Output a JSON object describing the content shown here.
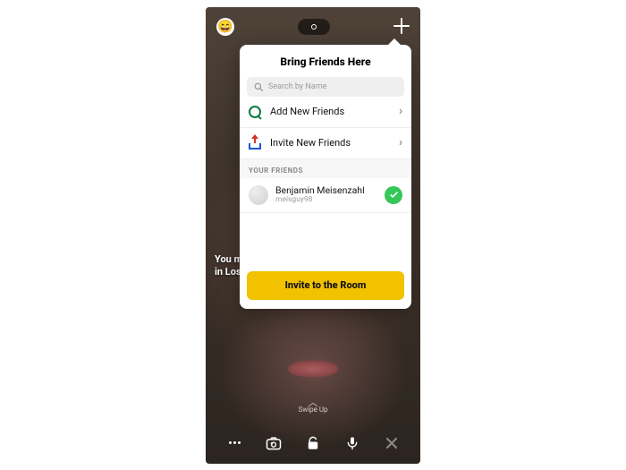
{
  "topbar": {
    "emoji": "😄"
  },
  "background_message": {
    "line1": "You m",
    "line2": "in Los"
  },
  "popover": {
    "title": "Bring Friends Here",
    "search_placeholder": "Search by Name",
    "actions": {
      "add_friends": "Add New Friends",
      "invite_friends": "Invite New Friends"
    },
    "section": "YOUR FRIENDS",
    "friends": [
      {
        "name": "Benjamin Meisenzahl",
        "username": "meisguy98",
        "selected": true
      }
    ],
    "invite_button": "Invite to the Room"
  },
  "swipe_hint": "Swipe Up"
}
